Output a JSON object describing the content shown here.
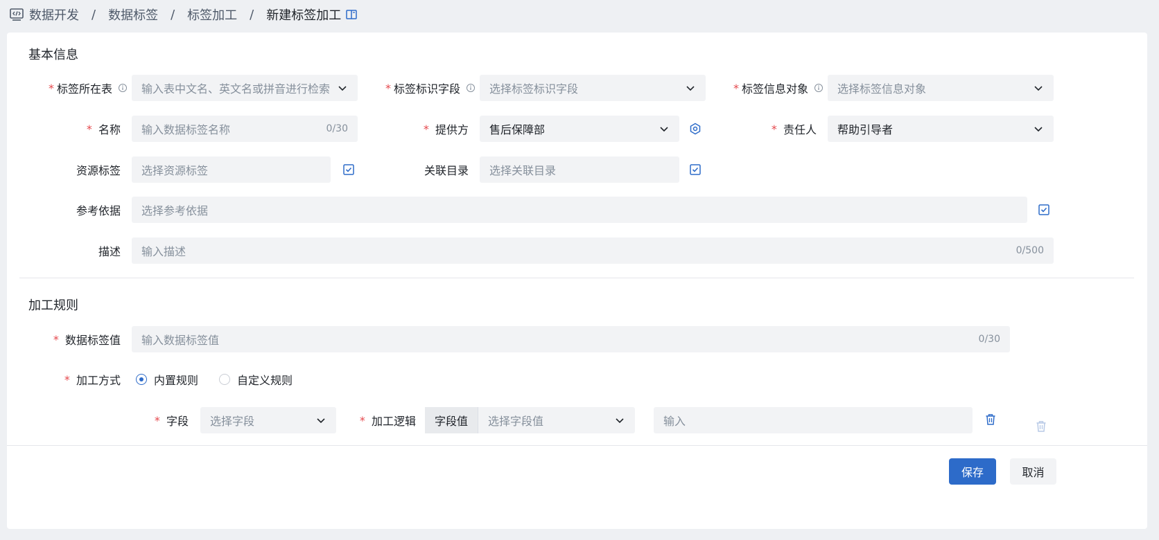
{
  "breadcrumb": {
    "items": [
      "数据开发",
      "数据标签",
      "标签加工",
      "新建标签加工"
    ],
    "separator": "/"
  },
  "sections": {
    "basic": "基本信息",
    "rules": "加工规则"
  },
  "basic_form": {
    "table": {
      "label": "标签所在表",
      "placeholder": "输入表中文名、英文名或拼音进行检索"
    },
    "id_field": {
      "label": "标签标识字段",
      "placeholder": "选择标签标识字段"
    },
    "info_object": {
      "label": "标签信息对象",
      "placeholder": "选择标签信息对象"
    },
    "name": {
      "label": "名称",
      "placeholder": "输入数据标签名称",
      "count": "0/30"
    },
    "provider": {
      "label": "提供方",
      "value": "售后保障部"
    },
    "owner": {
      "label": "责任人",
      "value": "帮助引导者"
    },
    "resource_tag": {
      "label": "资源标签",
      "placeholder": "选择资源标签"
    },
    "related_catalog": {
      "label": "关联目录",
      "placeholder": "选择关联目录"
    },
    "reference": {
      "label": "参考依据",
      "placeholder": "选择参考依据"
    },
    "description": {
      "label": "描述",
      "placeholder": "输入描述",
      "count": "0/500"
    }
  },
  "rules_form": {
    "tag_value": {
      "label": "数据标签值",
      "placeholder": "输入数据标签值",
      "count": "0/30"
    },
    "method": {
      "label": "加工方式",
      "options": [
        "内置规则",
        "自定义规则"
      ],
      "selected": "内置规则"
    },
    "field": {
      "label": "字段",
      "placeholder": "选择字段"
    },
    "logic": {
      "label": "加工逻辑",
      "prefix": "字段值",
      "placeholder": "选择字段值"
    },
    "input": {
      "placeholder": "输入"
    }
  },
  "footer": {
    "save": "保存",
    "cancel": "取消"
  },
  "colors": {
    "primary": "#2d6bc9",
    "required": "#e5484d",
    "field_bg": "#f2f3f5"
  }
}
